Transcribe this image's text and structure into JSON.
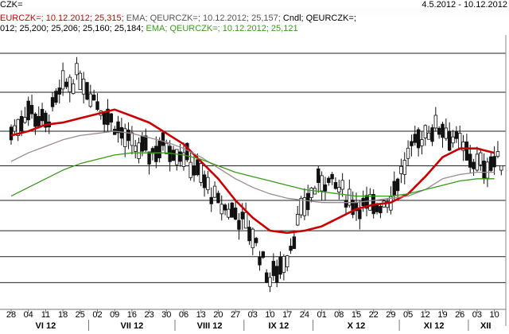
{
  "header": {
    "symbol": "CZK=",
    "date": "4.5.2012 - 10.12.2012",
    "legend_line_1": [
      {
        "text": "EURCZK=; 10.12.2012; 25,315;",
        "color": "#cc0000"
      },
      {
        "text": " EMA; QEURCZK=; 10.12.2012; 25,157;",
        "color": "#555555"
      },
      {
        "text": " Cndl; QEURCZK=;",
        "color": "#000000"
      }
    ],
    "legend_line_2": [
      {
        "text": "012; 25,200; 25,206; 25,160; 25,184;",
        "color": "#000000"
      },
      {
        "text": " EMA; QEURCZK=; 10.12.2012; 25,121",
        "color": "#3a9a1a"
      }
    ]
  },
  "chart_data": {
    "type": "candlestick",
    "y_gridlines": [
      24.62,
      24.74,
      24.86,
      25.0,
      25.16,
      25.32,
      25.5,
      25.68
    ],
    "ylim": [
      24.5,
      25.75
    ],
    "x_tick_labels": [
      "28",
      "04",
      "11",
      "18",
      "25",
      "02",
      "09",
      "16",
      "23",
      "30",
      "06",
      "13",
      "20",
      "27",
      "03",
      "10",
      "17",
      "24",
      "01",
      "08",
      "15",
      "22",
      "29",
      "05",
      "12",
      "19",
      "26",
      "03",
      "10"
    ],
    "month_labels": [
      "VI 12",
      "VII 12",
      "VIII 12",
      "IX 12",
      "X 12",
      "XI 12",
      "XII"
    ],
    "series": [
      {
        "kind": "candles",
        "points": [
          [
            "28",
            25.31
          ],
          [
            "04",
            25.42
          ],
          [
            "11",
            25.35
          ],
          [
            "18",
            25.52
          ],
          [
            "25",
            25.58
          ],
          [
            "02",
            25.45
          ],
          [
            "09",
            25.35
          ],
          [
            "16",
            25.25
          ],
          [
            "23",
            25.22
          ],
          [
            "30",
            25.26
          ],
          [
            "06",
            25.21
          ],
          [
            "13",
            25.11
          ],
          [
            "20",
            24.98
          ],
          [
            "27",
            24.94
          ],
          [
            "03",
            24.84
          ],
          [
            "10",
            24.63
          ],
          [
            "17",
            24.75
          ],
          [
            "24",
            24.98
          ],
          [
            "01",
            25.1
          ],
          [
            "08",
            25.05
          ],
          [
            "15",
            24.98
          ],
          [
            "22",
            24.96
          ],
          [
            "29",
            25.02
          ],
          [
            "05",
            25.2
          ],
          [
            "12",
            25.32
          ],
          [
            "19",
            25.34
          ],
          [
            "26",
            25.25
          ],
          [
            "03",
            25.16
          ],
          [
            "10",
            25.18
          ]
        ]
      },
      {
        "kind": "line",
        "color": "#cc0000",
        "points": [
          [
            "28",
            25.3
          ],
          [
            "04",
            25.32
          ],
          [
            "11",
            25.35
          ],
          [
            "18",
            25.36
          ],
          [
            "25",
            25.38
          ],
          [
            "02",
            25.4
          ],
          [
            "09",
            25.42
          ],
          [
            "16",
            25.39
          ],
          [
            "23",
            25.36
          ],
          [
            "30",
            25.31
          ],
          [
            "06",
            25.26
          ],
          [
            "13",
            25.18
          ],
          [
            "20",
            25.1
          ],
          [
            "27",
            25.0
          ],
          [
            "03",
            24.92
          ],
          [
            "10",
            24.86
          ],
          [
            "17",
            24.85
          ],
          [
            "24",
            24.86
          ],
          [
            "01",
            24.88
          ],
          [
            "08",
            24.92
          ],
          [
            "15",
            24.96
          ],
          [
            "22",
            24.98
          ],
          [
            "29",
            24.99
          ],
          [
            "05",
            25.03
          ],
          [
            "12",
            25.11
          ],
          [
            "19",
            25.2
          ],
          [
            "26",
            25.24
          ],
          [
            "03",
            25.24
          ],
          [
            "10",
            25.22
          ]
        ]
      },
      {
        "kind": "line",
        "color": "#9a8a96",
        "points": [
          [
            "28",
            25.18
          ],
          [
            "04",
            25.22
          ],
          [
            "11",
            25.25
          ],
          [
            "18",
            25.28
          ],
          [
            "25",
            25.3
          ],
          [
            "02",
            25.31
          ],
          [
            "09",
            25.32
          ],
          [
            "16",
            25.31
          ],
          [
            "23",
            25.29
          ],
          [
            "30",
            25.27
          ],
          [
            "06",
            25.24
          ],
          [
            "13",
            25.2
          ],
          [
            "20",
            25.15
          ],
          [
            "27",
            25.1
          ],
          [
            "03",
            25.06
          ],
          [
            "10",
            25.03
          ],
          [
            "17",
            25.01
          ],
          [
            "24",
            25.0
          ],
          [
            "01",
            24.99
          ],
          [
            "08",
            24.99
          ],
          [
            "15",
            24.99
          ],
          [
            "22",
            25.0
          ],
          [
            "29",
            25.01
          ],
          [
            "05",
            25.02
          ],
          [
            "12",
            25.05
          ],
          [
            "19",
            25.1
          ],
          [
            "26",
            25.12
          ],
          [
            "03",
            25.13
          ],
          [
            "10",
            25.13
          ]
        ]
      },
      {
        "kind": "line",
        "color": "#3a9a1a",
        "points": [
          [
            "28",
            25.02
          ],
          [
            "04",
            25.06
          ],
          [
            "11",
            25.1
          ],
          [
            "18",
            25.14
          ],
          [
            "25",
            25.17
          ],
          [
            "02",
            25.19
          ],
          [
            "09",
            25.21
          ],
          [
            "16",
            25.22
          ],
          [
            "23",
            25.22
          ],
          [
            "30",
            25.22
          ],
          [
            "06",
            25.21
          ],
          [
            "13",
            25.19
          ],
          [
            "20",
            25.16
          ],
          [
            "27",
            25.13
          ],
          [
            "03",
            25.11
          ],
          [
            "10",
            25.09
          ],
          [
            "17",
            25.07
          ],
          [
            "24",
            25.05
          ],
          [
            "01",
            25.04
          ],
          [
            "08",
            25.03
          ],
          [
            "15",
            25.02
          ],
          [
            "22",
            25.02
          ],
          [
            "29",
            25.02
          ],
          [
            "05",
            25.03
          ],
          [
            "12",
            25.05
          ],
          [
            "19",
            25.07
          ],
          [
            "26",
            25.09
          ],
          [
            "03",
            25.1
          ],
          [
            "10",
            25.1
          ]
        ]
      }
    ]
  }
}
